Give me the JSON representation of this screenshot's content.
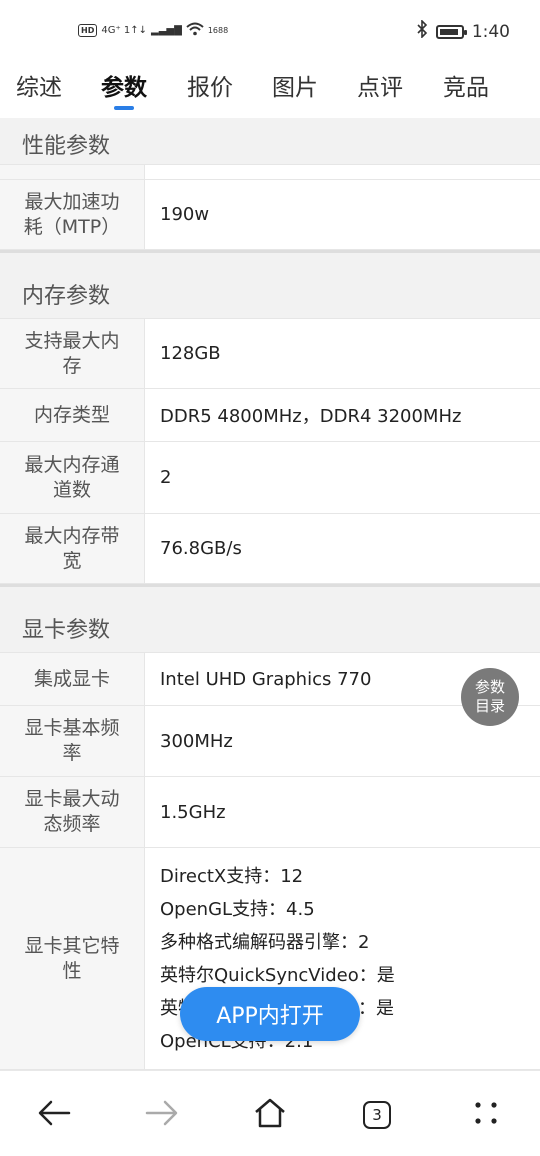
{
  "status_bar": {
    "left_hd": "HD",
    "left_signal": "4G⁺ 1↑↓",
    "left_speed": "1688",
    "time": "1:40"
  },
  "tabs": [
    {
      "label": "综述"
    },
    {
      "label": "参数"
    },
    {
      "label": "报价"
    },
    {
      "label": "图片"
    },
    {
      "label": "点评"
    },
    {
      "label": "竞品"
    }
  ],
  "active_tab": "参数",
  "sections": {
    "performance": {
      "title": "性能参数",
      "rows": [
        {
          "label": "最大加速功耗（MTP）",
          "value": "190w"
        }
      ]
    },
    "memory": {
      "title": "内存参数",
      "rows": [
        {
          "label": "支持最大内存",
          "value": "128GB"
        },
        {
          "label": "内存类型",
          "value": "DDR5 4800MHz，DDR4 3200MHz"
        },
        {
          "label": "最大内存通道数",
          "value": "2"
        },
        {
          "label": "最大内存带宽",
          "value": "76.8GB/s"
        }
      ]
    },
    "graphics": {
      "title": "显卡参数",
      "rows": [
        {
          "label": "集成显卡",
          "value": "Intel UHD Graphics 770"
        },
        {
          "label": "显卡基本频率",
          "value": "300MHz"
        },
        {
          "label": "显卡最大动态频率",
          "value": "1.5GHz"
        }
      ],
      "other": {
        "label": "显卡其它特性",
        "lines": [
          "DirectX支持：12",
          "OpenGL支持：4.5",
          "多种格式编解码器引擎：2",
          "英特尔QuickSyncVideo：是",
          "英特尔清晰视频高清技术：是",
          "OpenCL支持：2.1"
        ]
      }
    }
  },
  "floating": {
    "toc_line1": "参数",
    "toc_line2": "目录",
    "app_open": "APP内打开"
  },
  "bottom_nav": {
    "tab_count": "3"
  },
  "colors": {
    "accent": "#2a7ee6",
    "app_button": "#2e8cf0"
  }
}
